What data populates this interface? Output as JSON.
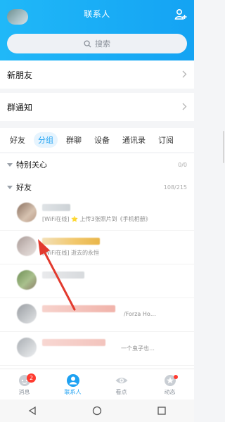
{
  "header": {
    "title": "联系人",
    "search_placeholder": "搜索"
  },
  "entries": [
    {
      "label": "新朋友"
    },
    {
      "label": "群通知"
    }
  ],
  "tabs": [
    {
      "label": "好友",
      "active": false
    },
    {
      "label": "分组",
      "active": true
    },
    {
      "label": "群聊",
      "active": false
    },
    {
      "label": "设备",
      "active": false
    },
    {
      "label": "通讯录",
      "active": false
    },
    {
      "label": "订阅",
      "active": false
    }
  ],
  "groups": {
    "special": {
      "label": "特别关心",
      "count": "0/0"
    },
    "friends": {
      "label": "好友",
      "count": "108/215"
    }
  },
  "contacts": [
    {
      "status": "[WiFi在线] ⭐ 上传3张照片到《手机相册》"
    },
    {
      "status": "[WiFi在线] 逝去的永恒"
    },
    {
      "status": ""
    },
    {
      "status": "/Forza Ho…"
    },
    {
      "status": "一个虫子也…"
    },
    {
      "status": ""
    }
  ],
  "nav": {
    "items": [
      {
        "label": "消息",
        "badge": "2"
      },
      {
        "label": "联系人"
      },
      {
        "label": "看点"
      },
      {
        "label": "动态"
      }
    ]
  },
  "colors": {
    "accent": "#1da1f2",
    "header_bg": "#18aaf4",
    "badge": "#ff3b30"
  }
}
